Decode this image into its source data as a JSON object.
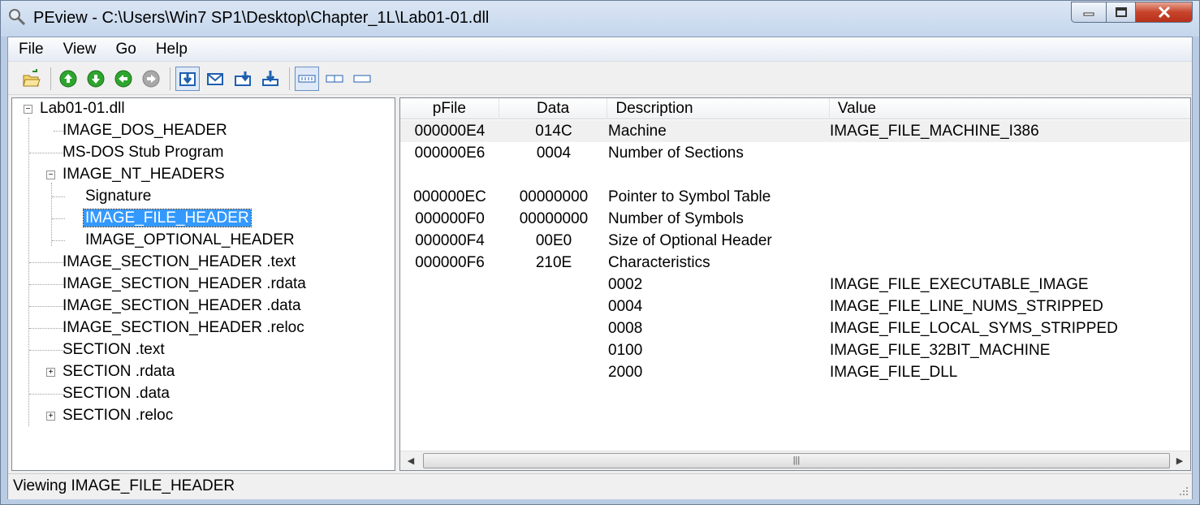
{
  "window": {
    "title": "PEview - C:\\Users\\Win7 SP1\\Desktop\\Chapter_1L\\Lab01-01.dll",
    "app_icon": "magnifier-icon",
    "controls": [
      "minimize-icon",
      "maximize-icon",
      "close-icon"
    ]
  },
  "menu": [
    "File",
    "View",
    "Go",
    "Help"
  ],
  "toolbar": {
    "buttons": [
      "open-file-icon",
      "up-icon",
      "down-icon",
      "back-icon",
      "forward-icon",
      "view-byte-icon",
      "view-word-icon",
      "view-dword-icon",
      "view-qword-icon",
      "detail-view-icon",
      "list-view-icon",
      "small-view-icon"
    ]
  },
  "tree": {
    "root": "Lab01-01.dll",
    "items": [
      "IMAGE_DOS_HEADER",
      "MS-DOS Stub Program",
      "IMAGE_NT_HEADERS",
      "Signature",
      "IMAGE_FILE_HEADER",
      "IMAGE_OPTIONAL_HEADER",
      "IMAGE_SECTION_HEADER .text",
      "IMAGE_SECTION_HEADER .rdata",
      "IMAGE_SECTION_HEADER .data",
      "IMAGE_SECTION_HEADER .reloc",
      "SECTION .text",
      "SECTION .rdata",
      "SECTION .data",
      "SECTION .reloc"
    ],
    "selected": "IMAGE_FILE_HEADER"
  },
  "table": {
    "columns": [
      "pFile",
      "Data",
      "Description",
      "Value"
    ],
    "rows": [
      {
        "pfile": "000000E4",
        "data": "014C",
        "desc": "Machine",
        "value": "IMAGE_FILE_MACHINE_I386"
      },
      {
        "pfile": "000000E6",
        "data": "0004",
        "desc": "Number of Sections",
        "value": ""
      },
      {
        "pfile": "",
        "data": "",
        "desc": "",
        "value": ""
      },
      {
        "pfile": "000000EC",
        "data": "00000000",
        "desc": "Pointer to Symbol Table",
        "value": ""
      },
      {
        "pfile": "000000F0",
        "data": "00000000",
        "desc": "Number of Symbols",
        "value": ""
      },
      {
        "pfile": "000000F4",
        "data": "00E0",
        "desc": "Size of Optional Header",
        "value": ""
      },
      {
        "pfile": "000000F6",
        "data": "210E",
        "desc": "Characteristics",
        "value": ""
      },
      {
        "pfile": "",
        "data": "",
        "desc": "0002",
        "value": "IMAGE_FILE_EXECUTABLE_IMAGE"
      },
      {
        "pfile": "",
        "data": "",
        "desc": "0004",
        "value": "IMAGE_FILE_LINE_NUMS_STRIPPED"
      },
      {
        "pfile": "",
        "data": "",
        "desc": "0008",
        "value": "IMAGE_FILE_LOCAL_SYMS_STRIPPED"
      },
      {
        "pfile": "",
        "data": "",
        "desc": "0100",
        "value": "IMAGE_FILE_32BIT_MACHINE"
      },
      {
        "pfile": "",
        "data": "",
        "desc": "2000",
        "value": "IMAGE_FILE_DLL"
      }
    ]
  },
  "status": "Viewing IMAGE_FILE_HEADER",
  "colors": {
    "selection": "#3399ff",
    "title_bar": "#c4d6ec"
  }
}
